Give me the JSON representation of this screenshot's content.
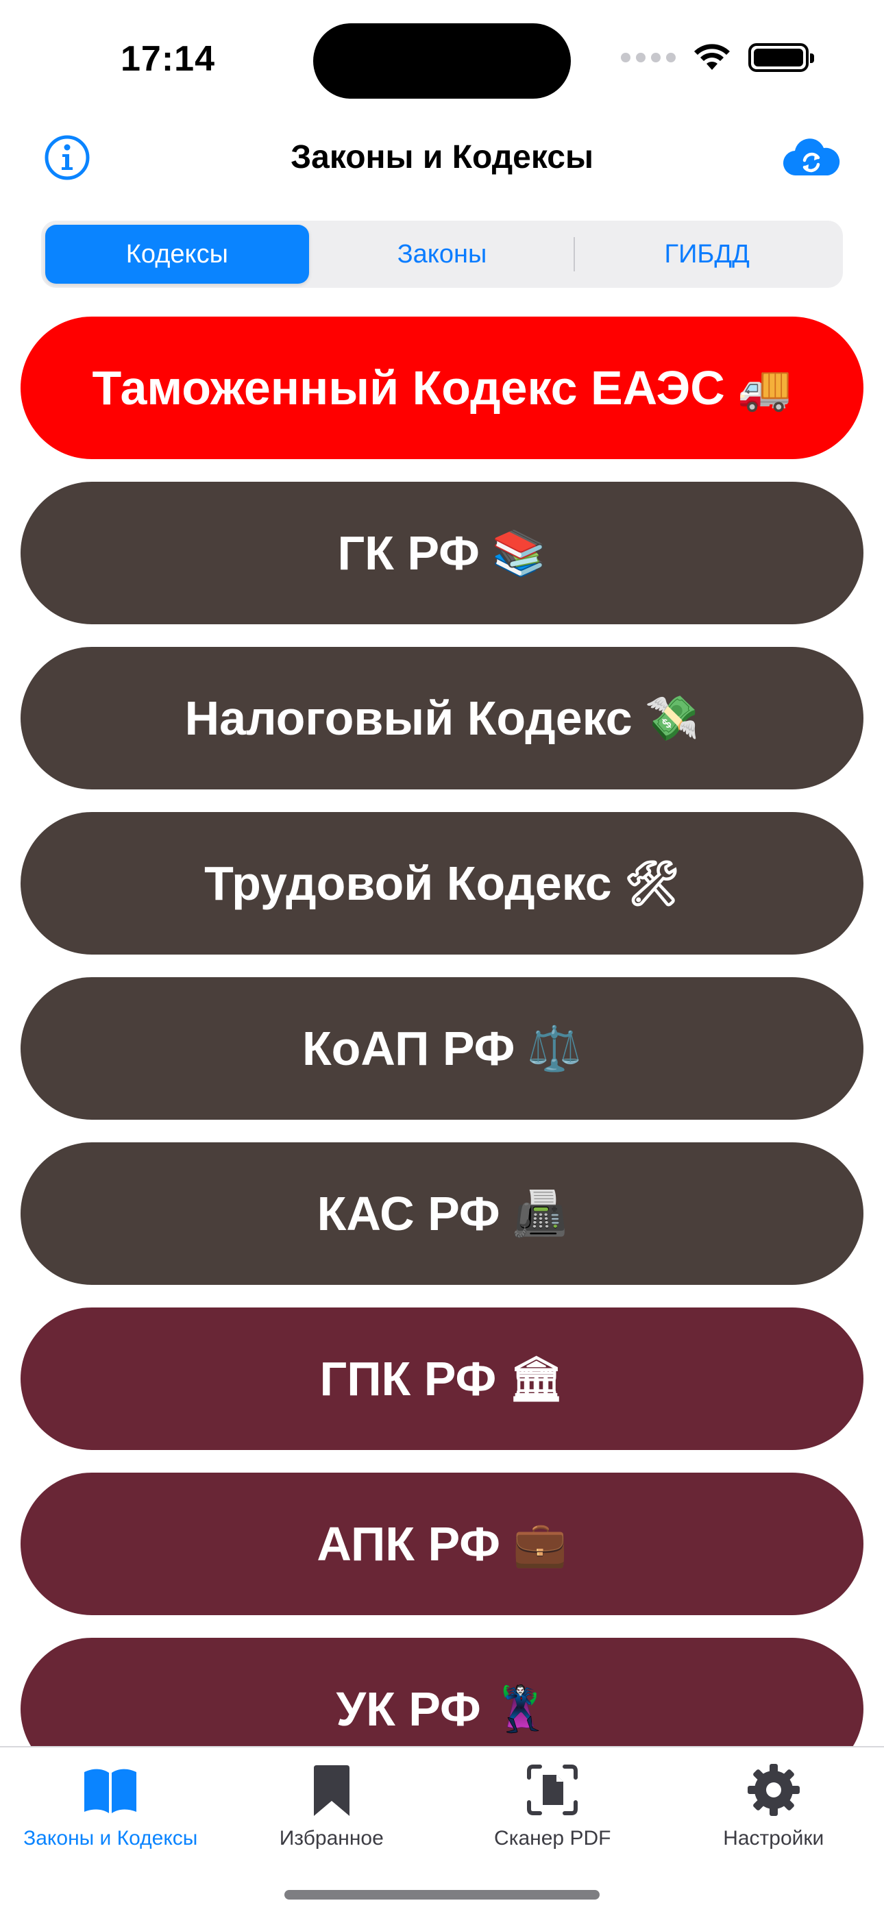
{
  "status_bar": {
    "time": "17:14"
  },
  "nav": {
    "title": "Законы и Кодексы",
    "info_icon": "info-circle-icon",
    "sync_icon": "icloud-sync-icon",
    "accent_color": "#0a84ff"
  },
  "segments": [
    {
      "label": "Кодексы",
      "active": true
    },
    {
      "label": "Законы",
      "active": false
    },
    {
      "label": "ГИБДД",
      "active": false
    }
  ],
  "codes": [
    {
      "label": "Таможенный Кодекс ЕАЭС",
      "emoji": "🚚",
      "emoji_icon": "delivery-truck-icon",
      "color": "#ff0000"
    },
    {
      "label": "ГК РФ",
      "emoji": "📚",
      "emoji_icon": "books-icon",
      "color": "#4a3f3b"
    },
    {
      "label": "Налоговый Кодекс",
      "emoji": "💸",
      "emoji_icon": "money-with-wings-icon",
      "color": "#4a3f3b"
    },
    {
      "label": "Трудовой Кодекс",
      "emoji": "🛠",
      "emoji_icon": "hammer-wrench-icon",
      "color": "#4a3f3b"
    },
    {
      "label": "КоАП РФ",
      "emoji": "⚖️",
      "emoji_icon": "scales-icon",
      "color": "#4a3f3b"
    },
    {
      "label": "КАС РФ",
      "emoji": "📠",
      "emoji_icon": "fax-machine-icon",
      "color": "#4a3f3b"
    },
    {
      "label": "ГПК РФ",
      "emoji": "🏛",
      "emoji_icon": "classical-building-icon",
      "color": "#692636"
    },
    {
      "label": "АПК РФ",
      "emoji": "💼",
      "emoji_icon": "briefcase-icon",
      "color": "#692636"
    },
    {
      "label": "УК РФ",
      "emoji": "🦹",
      "emoji_icon": "supervillain-icon",
      "color": "#692636"
    }
  ],
  "tabs": [
    {
      "label": "Законы и Кодексы",
      "icon": "book-icon",
      "active": true
    },
    {
      "label": "Избранное",
      "icon": "bookmark-icon",
      "active": false
    },
    {
      "label": "Сканер PDF",
      "icon": "document-scanner-icon",
      "active": false
    },
    {
      "label": "Настройки",
      "icon": "gear-icon",
      "active": false
    }
  ]
}
